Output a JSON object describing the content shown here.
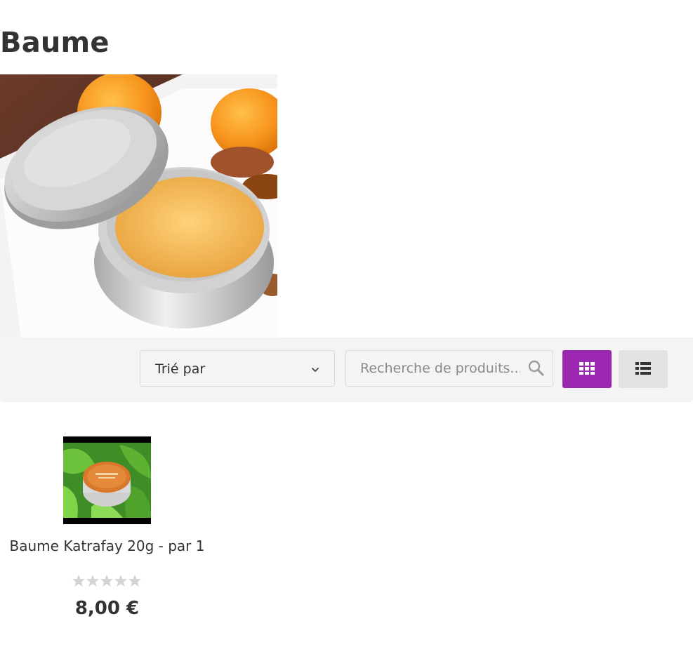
{
  "category": {
    "title": "Baume",
    "image_alt": "Baume"
  },
  "toolbar": {
    "sort_label": "Trié par",
    "search_placeholder": "Recherche de produits...",
    "colors": {
      "active_view": "#9c27b0",
      "inactive_view": "#e2e2e2",
      "background": "#f4f4f4"
    },
    "icons": {
      "sort": "chevron-down-icon",
      "search": "search-icon",
      "grid_view": "grid-icon",
      "list_view": "list-icon"
    }
  },
  "products": [
    {
      "name": "Baume Katrafay 20g - par 1",
      "price": "8,00 €",
      "rating": 0,
      "rating_max": 5
    }
  ]
}
